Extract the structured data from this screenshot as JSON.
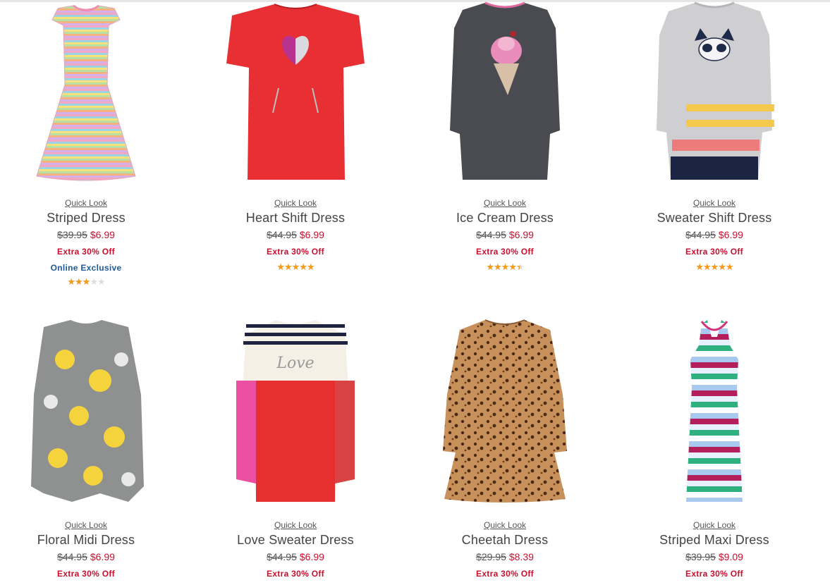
{
  "colors": {
    "sale": "#c8102e",
    "exclusive": "#1f5a96",
    "star": "#f29b1d"
  },
  "products": [
    {
      "quick_look": "Quick Look",
      "name": "Striped Dress",
      "original_price": "$39.95",
      "sale_price": "$6.99",
      "promo": "Extra 30% Off",
      "badge": "Online Exclusive",
      "rating": 3,
      "image_icon": "striped-dress-image"
    },
    {
      "quick_look": "Quick Look",
      "name": "Heart Shift Dress",
      "original_price": "$44.95",
      "sale_price": "$6.99",
      "promo": "Extra 30% Off",
      "rating": 5,
      "image_icon": "heart-shift-dress-image"
    },
    {
      "quick_look": "Quick Look",
      "name": "Ice Cream Dress",
      "original_price": "$44.95",
      "sale_price": "$6.99",
      "promo": "Extra 30% Off",
      "rating": 4.5,
      "image_icon": "ice-cream-dress-image"
    },
    {
      "quick_look": "Quick Look",
      "name": "Sweater Shift Dress",
      "original_price": "$44.95",
      "sale_price": "$6.99",
      "promo": "Extra 30% Off",
      "rating": 5,
      "image_icon": "sweater-shift-dress-image"
    },
    {
      "quick_look": "Quick Look",
      "name": "Floral Midi Dress",
      "original_price": "$44.95",
      "sale_price": "$6.99",
      "promo": "Extra 30% Off",
      "image_icon": "floral-midi-dress-image"
    },
    {
      "quick_look": "Quick Look",
      "name": "Love Sweater Dress",
      "original_price": "$44.95",
      "sale_price": "$6.99",
      "promo": "Extra 30% Off",
      "image_icon": "love-sweater-dress-image"
    },
    {
      "quick_look": "Quick Look",
      "name": "Cheetah Dress",
      "original_price": "$29.95",
      "sale_price": "$8.39",
      "promo": "Extra 30% Off",
      "image_icon": "cheetah-dress-image"
    },
    {
      "quick_look": "Quick Look",
      "name": "Striped Maxi Dress",
      "original_price": "$39.95",
      "sale_price": "$9.09",
      "promo": "Extra 30% Off",
      "image_icon": "striped-maxi-dress-image"
    }
  ]
}
